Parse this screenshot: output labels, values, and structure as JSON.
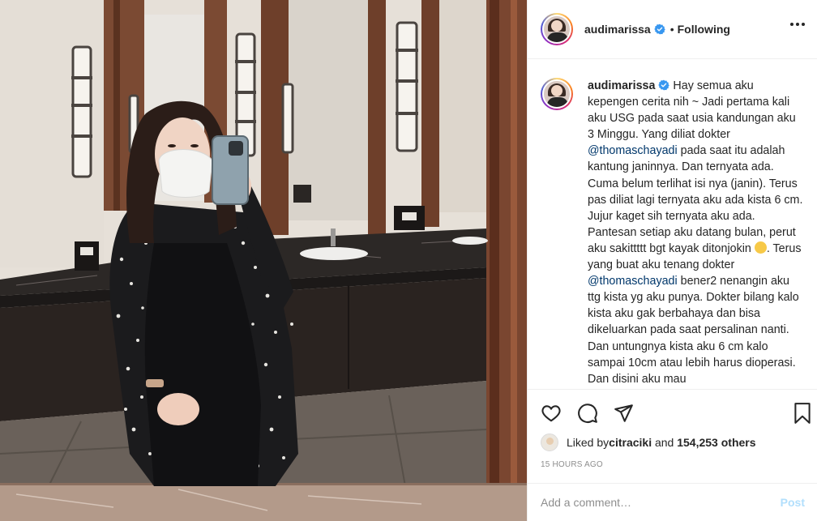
{
  "post": {
    "author": "audimarissa",
    "verified": true,
    "separator": "•",
    "follow_status": "Following",
    "photo_alt_icon": "post-photo",
    "caption": {
      "username": "audimarissa",
      "text_1": " Hay semua aku kepengen cerita nih ~ Jadi pertama kali aku USG pada saat usia kandungan aku 3 Minggu. Yang diliat dokter ",
      "mention_1": "@thomaschayadi",
      "text_2": " pada saat itu adalah kantung janinnya. Dan ternyata ada. Cuma belum terlihat isi nya (janin). Terus pas diliat lagi ternyata aku ada kista 6 cm. Jujur kaget sih ternyata aku ada. Pantesan setiap aku datang bulan, perut aku sakittttt bgt kayak ditonjokin ",
      "emoji": "disappointed-face",
      "text_3": ". Terus yang buat aku tenang dokter ",
      "mention_2": "@thomaschayadi",
      "text_4": " bener2 nenangin aku ttg kista yg aku punya. Dokter bilang kalo kista aku gak berbahaya dan bisa dikeluarkan pada saat persalinan nanti. Dan untungnya kista aku 6 cm kalo sampai 10cm atau lebih harus dioperasi. Dan disini aku mau"
    },
    "likes": {
      "prefix": "Liked by ",
      "user": "citraciki",
      "middle": " and ",
      "count": "154,253 others"
    },
    "timestamp": "15 HOURS AGO",
    "comment_placeholder": "Add a comment…",
    "post_label": "Post"
  },
  "icons": {
    "like": "heart-icon",
    "comment": "comment-icon",
    "share": "paper-plane-icon",
    "save": "bookmark-icon",
    "more": "more-options-icon",
    "verified": "verified-badge-icon"
  },
  "colors": {
    "text": "#262626",
    "muted": "#8e8e8e",
    "link": "#00376b",
    "verified": "#3897f0",
    "post_button": "#b2dffc",
    "border": "#efefef"
  }
}
